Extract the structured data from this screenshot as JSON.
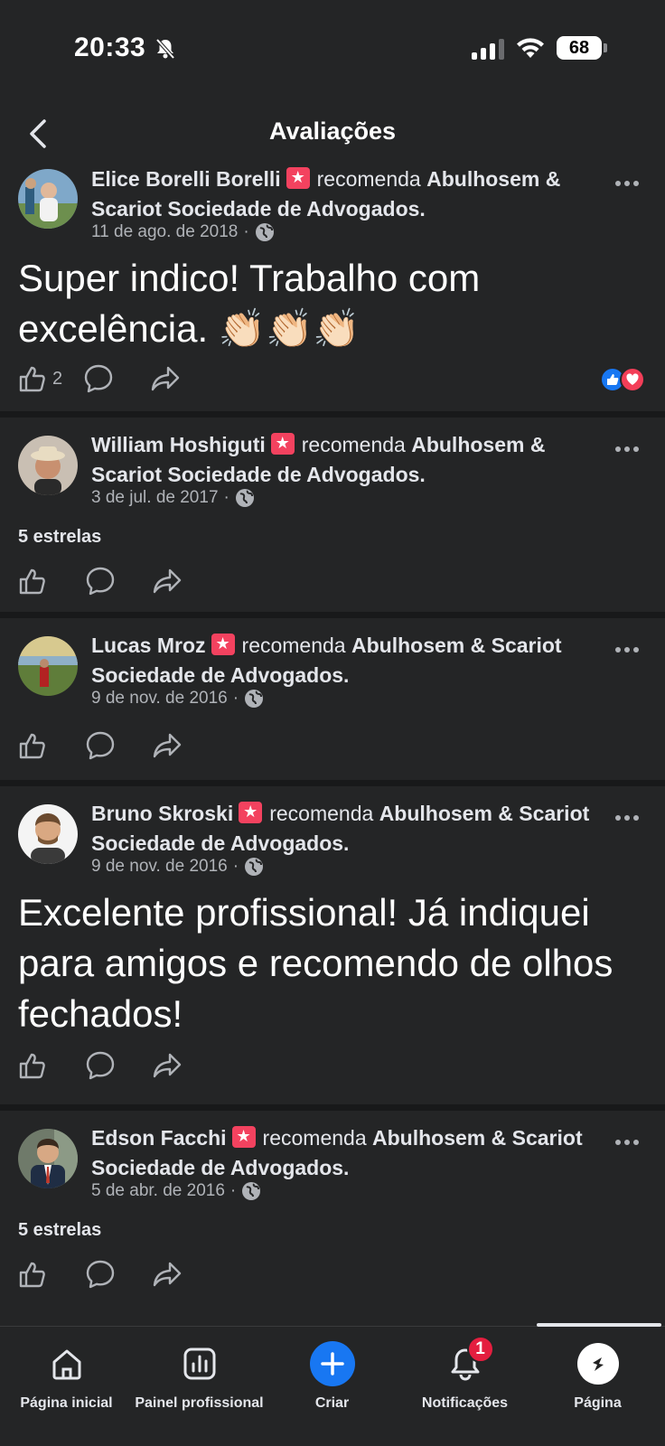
{
  "status_bar": {
    "time": "20:33",
    "battery": "68"
  },
  "header": {
    "title": "Avaliações"
  },
  "verb": "recomenda",
  "reviews": [
    {
      "name": "Elice Borelli Borelli",
      "page": "Abulhosem & Scariot Sociedade de Advogados.",
      "date": "11 de ago. de 2018",
      "text": "Super indico! Trabalho com excelência. 👏🏻👏🏻👏🏻",
      "like_count": "2"
    },
    {
      "name": "William Hoshiguti",
      "page": "Abulhosem & Scariot Sociedade de Advogados.",
      "date": "3 de jul. de 2017",
      "rating_text": "5 estrelas"
    },
    {
      "name": "Lucas Mroz",
      "page": "Abulhosem & Scariot Sociedade de Advogados.",
      "date": "9 de nov. de 2016"
    },
    {
      "name": "Bruno Skroski",
      "page": "Abulhosem & Scariot Sociedade de Advogados.",
      "date": "9 de nov. de 2016",
      "text": "Excelente profissional! Já indiquei para amigos e recomendo de olhos fechados!"
    },
    {
      "name": "Edson Facchi",
      "page": "Abulhosem & Scariot Sociedade de Advogados.",
      "date": "5 de abr. de 2016",
      "rating_text": "5 estrelas"
    }
  ],
  "bottom_nav": {
    "home": "Página inicial",
    "dashboard": "Painel profissional",
    "create": "Criar",
    "notifications": "Notificações",
    "notifications_badge": "1",
    "page": "Página"
  }
}
